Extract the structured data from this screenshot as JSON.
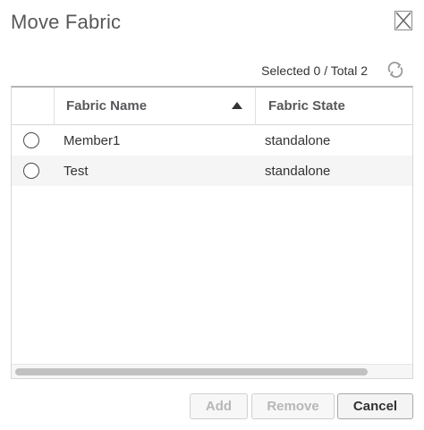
{
  "dialog": {
    "title": "Move Fabric"
  },
  "toolbar": {
    "selected_text": "Selected 0 / Total 2"
  },
  "table": {
    "columns": {
      "name": "Fabric Name",
      "state": "Fabric State"
    },
    "sort": {
      "column": "Fabric Name",
      "direction": "ascending"
    },
    "rows": [
      {
        "name": "Member1",
        "state": "standalone",
        "selected": false
      },
      {
        "name": "Test",
        "state": "standalone",
        "selected": false
      }
    ]
  },
  "buttons": {
    "add": "Add",
    "remove": "Remove",
    "cancel": "Cancel"
  },
  "icons": {
    "close": "close-icon",
    "refresh": "refresh-icon",
    "sort": "sort-ascending-icon"
  },
  "colors": {
    "title": "#58585b",
    "disabled_text": "#b7b7b7",
    "alt_row": "#f5f5f5"
  }
}
